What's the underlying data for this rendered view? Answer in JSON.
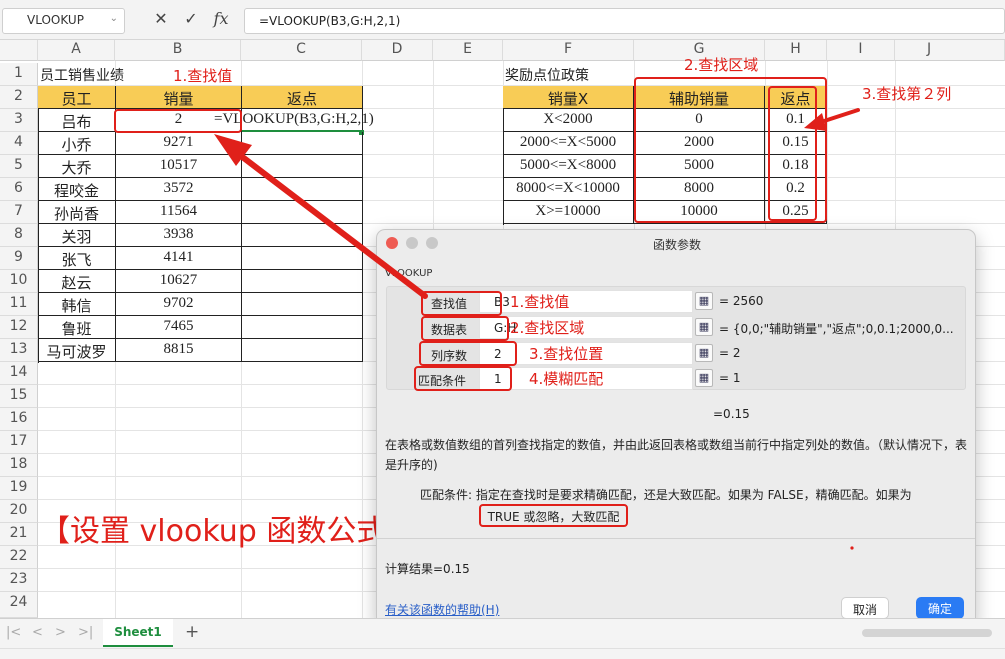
{
  "formula_bar": {
    "name_box": "VLOOKUP",
    "cancel_icon": "✕",
    "confirm_icon": "✓",
    "fx_label": "fx",
    "formula": "=VLOOKUP(B3,G:H,2,1)"
  },
  "columns": [
    "A",
    "B",
    "C",
    "D",
    "E",
    "F",
    "G",
    "H",
    "I",
    "J"
  ],
  "rows": [
    "1",
    "2",
    "3",
    "4",
    "5",
    "6",
    "7",
    "8",
    "9",
    "10",
    "11",
    "12",
    "13",
    "14",
    "15",
    "16",
    "17",
    "18",
    "19",
    "20",
    "21",
    "22",
    "23",
    "24"
  ],
  "sheet": {
    "a1": "员工销售业绩",
    "f1": "奖励点位政策",
    "headers_left": [
      "员工",
      "销量",
      "返点"
    ],
    "employees": [
      {
        "name": "吕布",
        "sales": "2"
      },
      {
        "name": "小乔",
        "sales": "9271"
      },
      {
        "name": "大乔",
        "sales": "10517"
      },
      {
        "name": "程咬金",
        "sales": "3572"
      },
      {
        "name": "孙尚香",
        "sales": "11564"
      },
      {
        "name": "关羽",
        "sales": "3938"
      },
      {
        "name": "张飞",
        "sales": "4141"
      },
      {
        "name": "赵云",
        "sales": "10627"
      },
      {
        "name": "韩信",
        "sales": "9702"
      },
      {
        "name": "鲁班",
        "sales": "7465"
      },
      {
        "name": "马可波罗",
        "sales": "8815"
      }
    ],
    "c3_formula": "=VLOOKUP(B3,G:H,2,1)",
    "headers_right": [
      "销量X",
      "辅助销量",
      "返点"
    ],
    "policy": [
      {
        "range": "X<2000",
        "aux": "0",
        "rebate": "0.1"
      },
      {
        "range": "2000<=X<5000",
        "aux": "2000",
        "rebate": "0.15"
      },
      {
        "range": "5000<=X<8000",
        "aux": "5000",
        "rebate": "0.18"
      },
      {
        "range": "8000<=X<10000",
        "aux": "8000",
        "rebate": "0.2"
      },
      {
        "range": "X>=10000",
        "aux": "10000",
        "rebate": "0.25"
      }
    ]
  },
  "annotations": {
    "lookup_value": "1.查找值",
    "lookup_area": "2.查找区域",
    "lookup_col": "3.查找第２列",
    "dlg_lookup_value": "1.查找值",
    "dlg_lookup_area": "2.查找区域",
    "dlg_lookup_pos": "3.查找位置",
    "dlg_fuzzy": "4.模糊匹配",
    "big_title": "【设置 vlookup 函数公式】",
    "accent_red": "#e0201a"
  },
  "dialog": {
    "title": "函数参数",
    "func_name": "VLOOKUP",
    "args": [
      {
        "label": "查找值",
        "value": "B3",
        "result": "= 2560"
      },
      {
        "label": "数据表",
        "value": "G:H",
        "result": "= {0,0;\"辅助销量\",\"返点\";0,0.1;2000,0..."
      },
      {
        "label": "列序数",
        "value": "2",
        "result": "= 2"
      },
      {
        "label": "匹配条件",
        "value": "1",
        "result": "= 1"
      }
    ],
    "overall_result": "=0.15",
    "description": "在表格或数值数组的首列查找指定的数值，并由此返回表格或数组当前行中指定列处的数值。（默认情况下，表是升序的)",
    "param_help": "匹配条件: 指定在查找时是要求精确匹配，还是大致匹配。如果为 FALSE，精确匹配。如果为",
    "param_help_highlight": "TRUE 或忽略，大致匹配",
    "calc_result": "计算结果=0.15",
    "help_link": "有关该函数的帮助(H)",
    "cancel": "取消",
    "ok": "确定"
  },
  "tabs": {
    "nav": [
      "|<",
      "<",
      ">",
      ">|"
    ],
    "sheet1": "Sheet1",
    "add": "+"
  }
}
